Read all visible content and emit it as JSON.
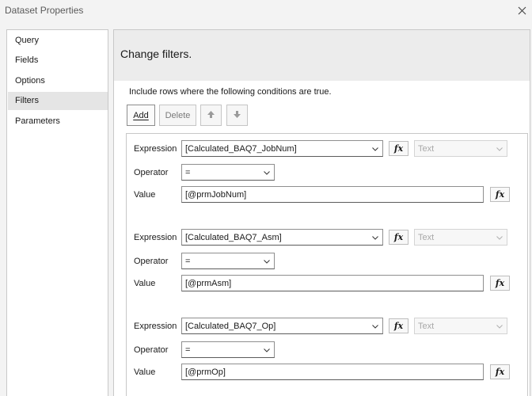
{
  "window": {
    "title": "Dataset Properties",
    "close_icon": "close-icon"
  },
  "sidebar": {
    "items": [
      {
        "label": "Query"
      },
      {
        "label": "Fields"
      },
      {
        "label": "Options"
      },
      {
        "label": "Filters",
        "selected": true
      },
      {
        "label": "Parameters"
      }
    ]
  },
  "main": {
    "title": "Change filters.",
    "hint": "Include rows where the following conditions are true."
  },
  "toolbar": {
    "add_label": "Add",
    "delete_label": "Delete",
    "move_up_icon": "arrow-up-icon",
    "move_down_icon": "arrow-down-icon"
  },
  "filters": [
    {
      "expression_label": "Expression",
      "expression": "[Calculated_BAQ7_JobNum]",
      "type": "Text",
      "operator_label": "Operator",
      "operator": "=",
      "value_label": "Value",
      "value": "[@prmJobNum]",
      "fx_label": "fx"
    },
    {
      "expression_label": "Expression",
      "expression": "[Calculated_BAQ7_Asm]",
      "type": "Text",
      "operator_label": "Operator",
      "operator": "=",
      "value_label": "Value",
      "value": "[@prmAsm]",
      "fx_label": "fx"
    },
    {
      "expression_label": "Expression",
      "expression": "[Calculated_BAQ7_Op]",
      "type": "Text",
      "operator_label": "Operator",
      "operator": "=",
      "value_label": "Value",
      "value": "[@prmOp]",
      "fx_label": "fx"
    }
  ],
  "colors": {
    "accent_selected": "#e5e5e5",
    "header_bg": "#ececec",
    "disabled_text": "#a8a8a8"
  }
}
